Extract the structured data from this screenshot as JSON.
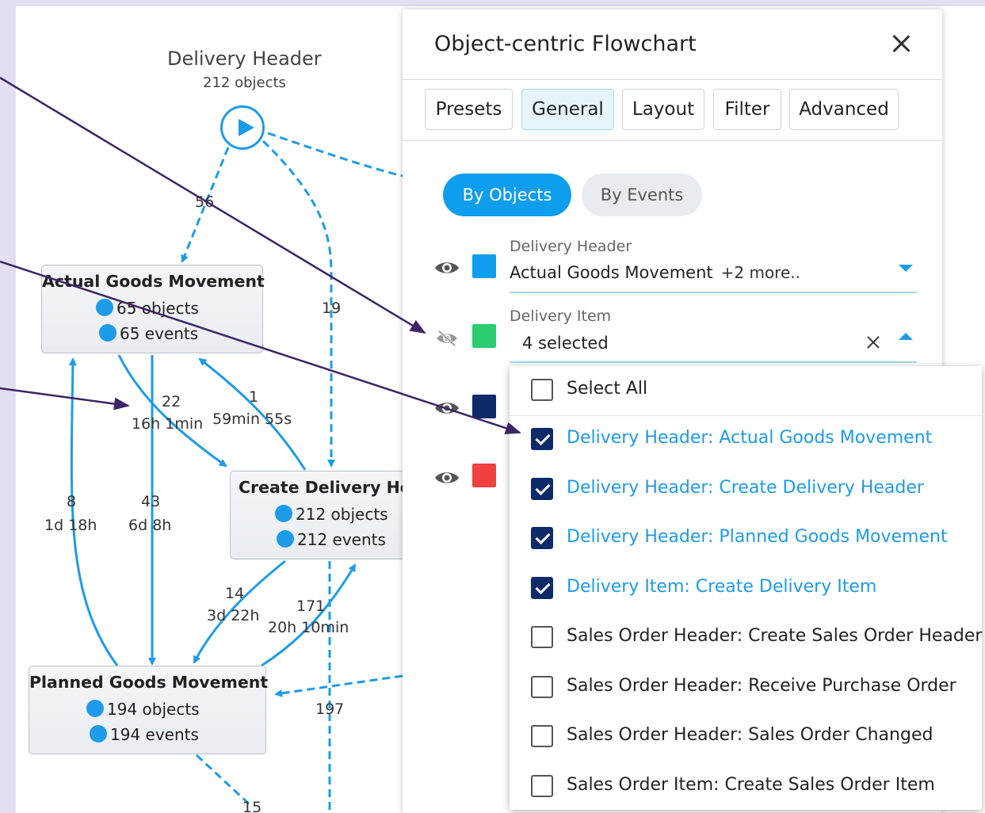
{
  "graph": {
    "start_node": {
      "title": "Delivery Header",
      "subtitle": "212 objects"
    },
    "boxes": {
      "actual": {
        "title": "Actual Goods Movement",
        "objects": "65 objects",
        "events": "65 events"
      },
      "create": {
        "title": "Create Delivery Hea",
        "objects": "212 objects",
        "events": "212 events"
      },
      "planned": {
        "title": "Planned Goods Movement",
        "objects": "194 objects",
        "events": "194 events"
      }
    },
    "edge_labels": {
      "e56": "56",
      "e19": "19",
      "e22": "22",
      "e22t": "16h 1min",
      "e1": "1",
      "e1t": "59min 55s",
      "e8": "8",
      "e8t": "1d 18h",
      "e43": "43",
      "e43t": "6d 8h",
      "e14": "14",
      "e14t": "3d 22h",
      "e171": "171",
      "e171t": "20h 10min",
      "e197": "197",
      "e15": "15"
    }
  },
  "panel": {
    "title": "Object-centric Flowchart",
    "tabs": [
      {
        "label": "Presets"
      },
      {
        "label": "General"
      },
      {
        "label": "Layout"
      },
      {
        "label": "Filter"
      },
      {
        "label": "Advanced"
      }
    ],
    "toggle": {
      "by_objects": "By Objects",
      "by_events": "By Events"
    },
    "rows": [
      {
        "type_label": "Delivery Header",
        "value": "Actual Goods Movement",
        "more": "+2 more..",
        "color": "#0f9ded"
      },
      {
        "type_label": "Delivery Item",
        "value": "4 selected",
        "color": "#2ecc71"
      },
      {
        "color": "#0d2a6b"
      },
      {
        "color": "#f04040"
      }
    ]
  },
  "dropdown": {
    "select_all": "Select All",
    "options": [
      {
        "label": "Delivery Header: Actual Goods Movement",
        "checked": true
      },
      {
        "label": "Delivery Header: Create Delivery Header",
        "checked": true
      },
      {
        "label": "Delivery Header: Planned Goods Movement",
        "checked": true
      },
      {
        "label": "Delivery Item: Create Delivery Item",
        "checked": true
      },
      {
        "label": "Sales Order Header: Create Sales Order Header",
        "checked": false
      },
      {
        "label": "Sales Order Header: Receive Purchase Order",
        "checked": false
      },
      {
        "label": "Sales Order Header: Sales Order Changed",
        "checked": false
      },
      {
        "label": "Sales Order Item: Create Sales Order Item",
        "checked": false
      }
    ]
  },
  "colors": {
    "accent": "#1e9be8",
    "annotation": "#3d2466"
  }
}
